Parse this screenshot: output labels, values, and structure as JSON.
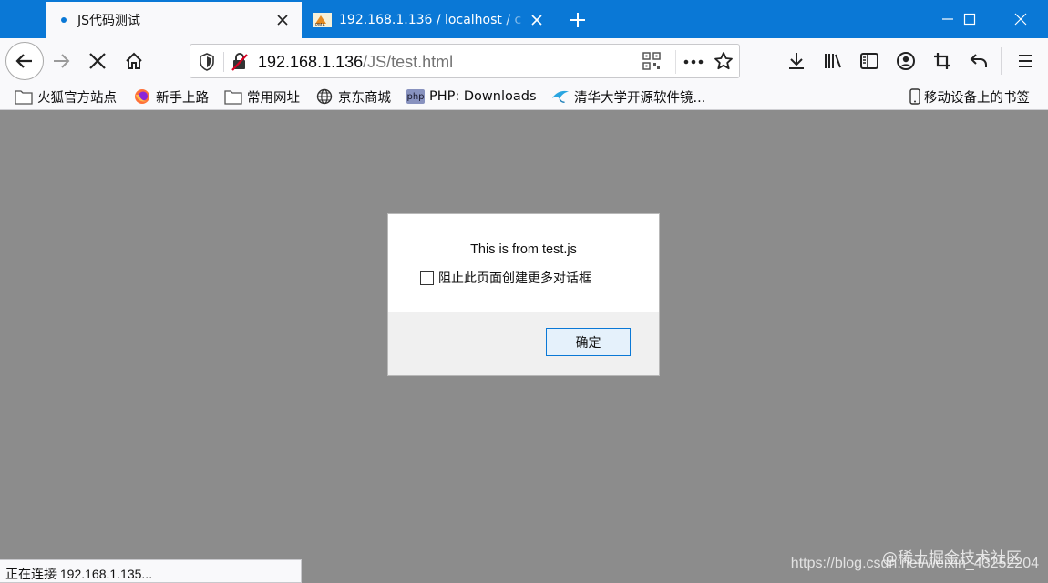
{
  "colors": {
    "titlebar": "#0a78d6",
    "toolbar": "#f9f9fb",
    "content_dim": "#8c8c8c",
    "accent": "#0a78d6",
    "insecure": "#d70022"
  },
  "tabs": [
    {
      "label": "JS代码测试",
      "active": true,
      "icon": "loading-dot-icon"
    },
    {
      "label": "192.168.1.136 / localhost / c",
      "active": false,
      "icon": "phpmyadmin-favicon"
    }
  ],
  "window": {
    "minimize_icon": "minimize-icon",
    "maximize_icon": "maximize-icon",
    "close_icon": "window-close-icon"
  },
  "navbar": {
    "url_host": "192.168.1.136",
    "url_path": "/JS/test.html"
  },
  "bookmarks": [
    {
      "label": "火狐官方站点",
      "icon": "folder-icon"
    },
    {
      "label": "新手上路",
      "icon": "firefox-icon"
    },
    {
      "label": "常用网址",
      "icon": "folder-icon"
    },
    {
      "label": "京东商城",
      "icon": "globe-icon"
    },
    {
      "label": "PHP: Downloads",
      "icon": "php-icon",
      "icon_text": "php"
    },
    {
      "label": "清华大学开源软件镜...",
      "icon": "bird-icon"
    }
  ],
  "mobile_bookmarks": {
    "label": "移动设备上的书签",
    "icon": "mobile-icon"
  },
  "dialog": {
    "message": "This is from test.js",
    "checkbox_label": "阻止此页面创建更多对话框",
    "ok_label": "确定"
  },
  "status": {
    "text": "正在连接 192.168.1.135..."
  },
  "watermark": {
    "text": "https://blog.csdn.net/weixin_43252204",
    "overlay": "@稀土掘金技术社区"
  }
}
